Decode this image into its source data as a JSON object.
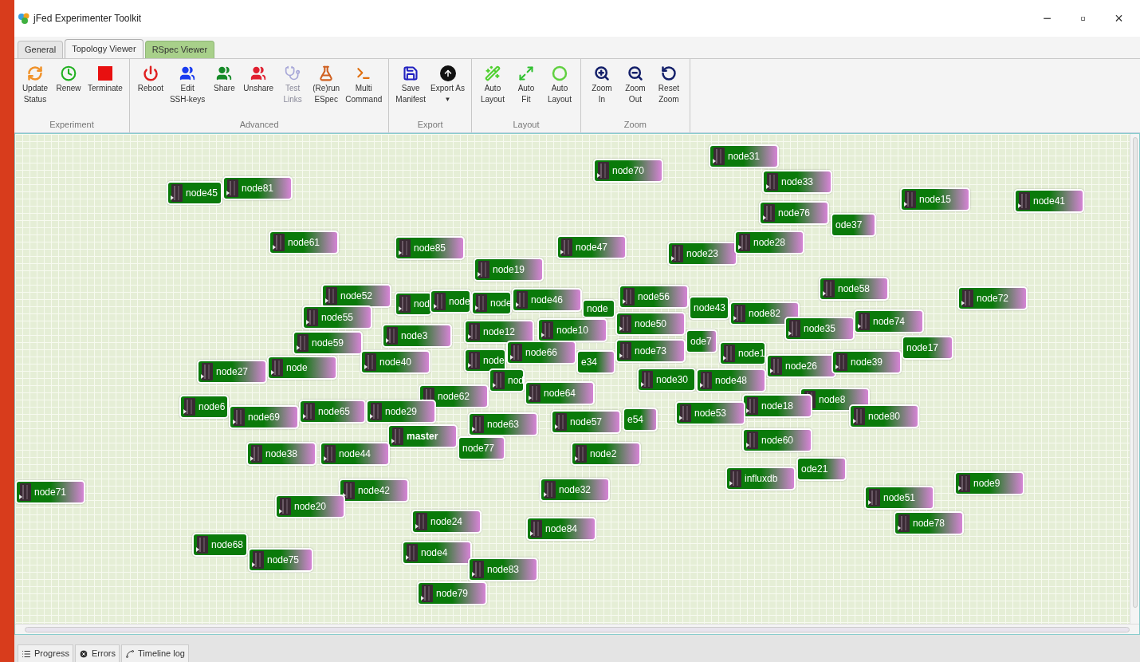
{
  "window": {
    "title": "jFed Experimenter Toolkit",
    "controls": [
      "−",
      "▫",
      "×"
    ]
  },
  "tabs": [
    {
      "label": "General",
      "selected": false
    },
    {
      "label": "Topology Viewer",
      "selected": true
    },
    {
      "label": "RSpec Viewer",
      "selected": false
    }
  ],
  "toolbar": [
    {
      "group": "Experiment",
      "buttons": [
        {
          "label": "Update\nStatus",
          "disabled": false
        },
        {
          "label": "Renew",
          "disabled": false
        },
        {
          "label": "Terminate",
          "disabled": false
        }
      ]
    },
    {
      "group": "Advanced",
      "buttons": [
        {
          "label": "Reboot",
          "disabled": false
        },
        {
          "label": "Edit\nSSH-keys",
          "disabled": false
        },
        {
          "label": "Share",
          "disabled": false
        },
        {
          "label": "Unshare",
          "disabled": false
        },
        {
          "label": "Test\nLinks",
          "disabled": true
        },
        {
          "label": "(Re)run\nESpec",
          "disabled": false
        },
        {
          "label": "Multi\nCommand",
          "disabled": false
        }
      ]
    },
    {
      "group": "Export",
      "buttons": [
        {
          "label": "Save\nManifest",
          "disabled": false
        },
        {
          "label": "Export As",
          "caret": "▼",
          "disabled": false
        }
      ]
    },
    {
      "group": "Layout",
      "buttons": [
        {
          "label": "Auto\nLayout",
          "disabled": false
        },
        {
          "label": "Auto\nFit",
          "disabled": false
        },
        {
          "label": "Auto\nLayout",
          "disabled": false
        }
      ]
    },
    {
      "group": "Zoom",
      "buttons": [
        {
          "label": "Zoom\nIn",
          "disabled": false
        },
        {
          "label": "Zoom\nOut",
          "disabled": false
        },
        {
          "label": "Reset\nZoom",
          "disabled": false
        }
      ]
    }
  ],
  "nodes": [
    {
      "label": "node31"
    },
    {
      "label": "node70"
    },
    {
      "label": "ode37"
    },
    {
      "label": "node33"
    },
    {
      "label": "node76"
    },
    {
      "label": "node15"
    },
    {
      "label": "node41"
    },
    {
      "label": "node45"
    },
    {
      "label": "node81"
    },
    {
      "label": "node61"
    },
    {
      "label": "node85"
    },
    {
      "label": "node47"
    },
    {
      "label": "node23"
    },
    {
      "label": "node28"
    },
    {
      "label": "node19"
    },
    {
      "label": "node58"
    },
    {
      "label": "node72"
    },
    {
      "label": "nod"
    },
    {
      "label": "node"
    },
    {
      "label": "node"
    },
    {
      "label": "node"
    },
    {
      "label": "node46"
    },
    {
      "label": "node43"
    },
    {
      "label": "node56"
    },
    {
      "label": "node82"
    },
    {
      "label": "node52"
    },
    {
      "label": "node55"
    },
    {
      "label": "node3"
    },
    {
      "label": "node12"
    },
    {
      "label": "node10"
    },
    {
      "label": "ode7"
    },
    {
      "label": "node50"
    },
    {
      "label": "node35"
    },
    {
      "label": "node74"
    },
    {
      "label": "node17"
    },
    {
      "label": "node"
    },
    {
      "label": "node59"
    },
    {
      "label": "node40"
    },
    {
      "label": "node"
    },
    {
      "label": "e34"
    },
    {
      "label": "node66"
    },
    {
      "label": "node73"
    },
    {
      "label": "node1"
    },
    {
      "label": "node26"
    },
    {
      "label": "node39"
    },
    {
      "label": "node27"
    },
    {
      "label": "nod"
    },
    {
      "label": "node64"
    },
    {
      "label": "node30"
    },
    {
      "label": "node48"
    },
    {
      "label": "node62"
    },
    {
      "label": "node8"
    },
    {
      "label": "node18"
    },
    {
      "label": "node6"
    },
    {
      "label": "node65"
    },
    {
      "label": "node69"
    },
    {
      "label": "node29"
    },
    {
      "label": "e54"
    },
    {
      "label": "node53"
    },
    {
      "label": "node63"
    },
    {
      "label": "node57"
    },
    {
      "label": "master",
      "bold": true
    },
    {
      "label": "node77"
    },
    {
      "label": "node80"
    },
    {
      "label": "node60"
    },
    {
      "label": "node38"
    },
    {
      "label": "node44"
    },
    {
      "label": "node2"
    },
    {
      "label": "ode21"
    },
    {
      "label": "influxdb"
    },
    {
      "label": "node71"
    },
    {
      "label": "node42"
    },
    {
      "label": "node32"
    },
    {
      "label": "node9"
    },
    {
      "label": "node51"
    },
    {
      "label": "node20"
    },
    {
      "label": "node24"
    },
    {
      "label": "node84"
    },
    {
      "label": "node78"
    },
    {
      "label": "node68"
    },
    {
      "label": "node75"
    },
    {
      "label": "node4"
    },
    {
      "label": "node83"
    },
    {
      "label": "node79"
    }
  ],
  "bottom_tabs": [
    {
      "label": "Progress"
    },
    {
      "label": "Errors"
    },
    {
      "label": "Timeline log"
    }
  ]
}
